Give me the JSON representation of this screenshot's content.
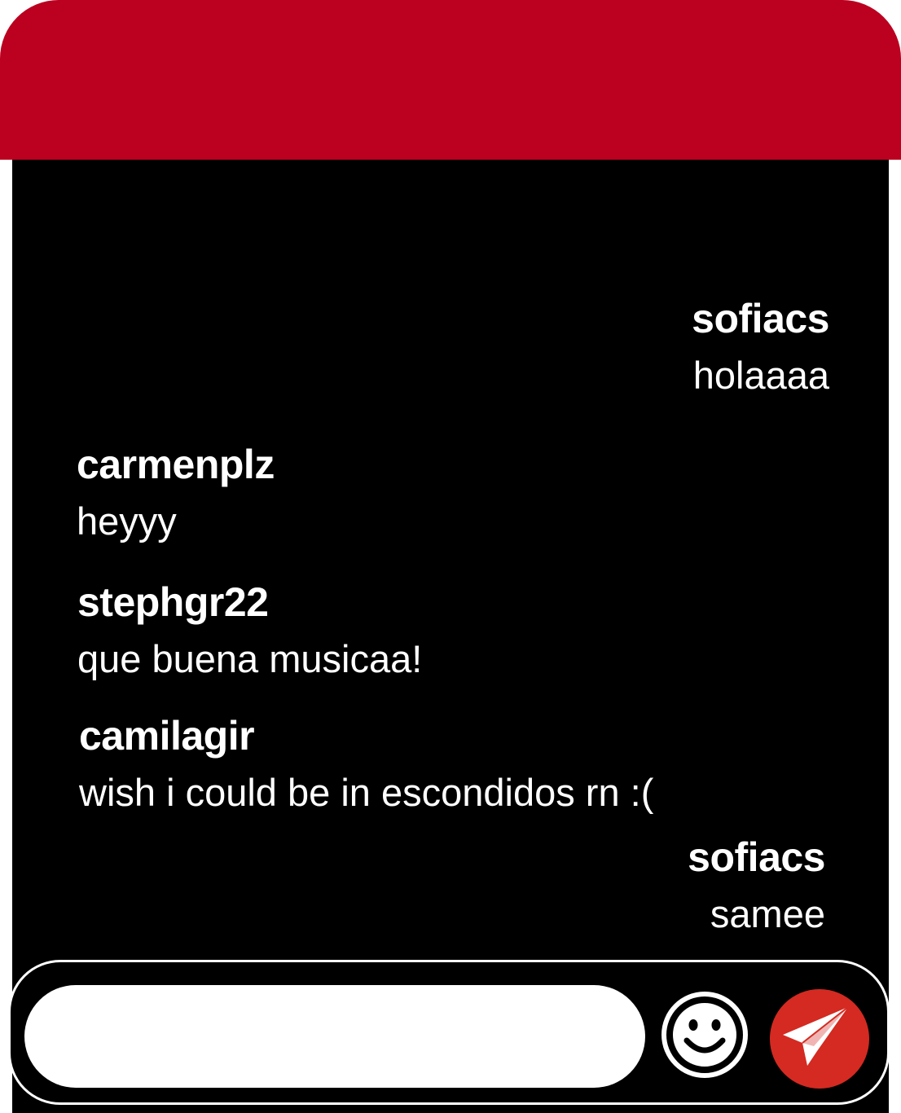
{
  "colors": {
    "header": "#bb0020",
    "background": "#000000",
    "text": "#ffffff",
    "send_button": "#d42a21"
  },
  "messages": [
    {
      "username": "sofiacs",
      "text": "holaaaa",
      "side": "right"
    },
    {
      "username": "carmenplz",
      "text": "heyyy",
      "side": "left"
    },
    {
      "username": "stephgr22",
      "text": "que buena musicaa!",
      "side": "left"
    },
    {
      "username": "camilagir",
      "text": "wish i could be in escondidos rn :(",
      "side": "left"
    },
    {
      "username": "sofiacs",
      "text": "samee",
      "side": "right"
    }
  ],
  "composer": {
    "input_value": "",
    "input_placeholder": "",
    "emoji_icon": "smiley-face-icon",
    "send_icon": "paper-plane-icon"
  }
}
